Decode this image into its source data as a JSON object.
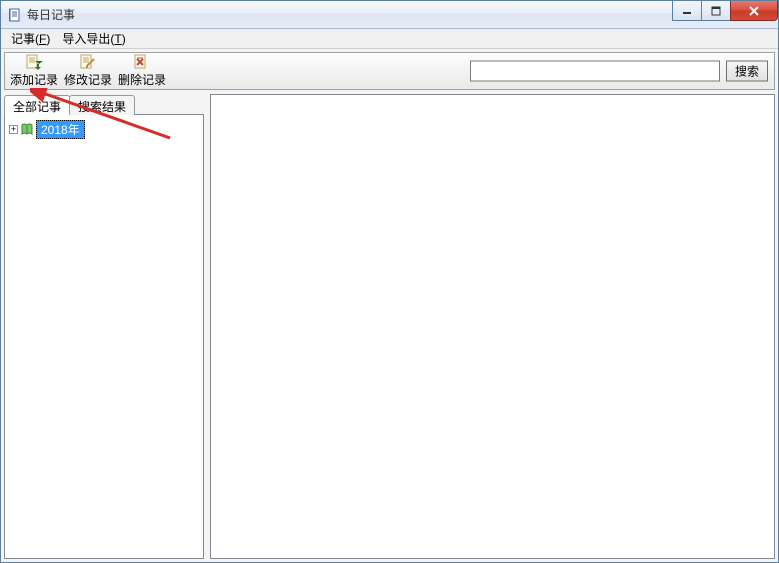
{
  "window": {
    "title": "每日记事"
  },
  "menubar": {
    "items": [
      {
        "label": "记事",
        "accel": "F"
      },
      {
        "label": "导入导出",
        "accel": "T"
      }
    ]
  },
  "toolbar": {
    "add_label": "添加记录",
    "edit_label": "修改记录",
    "delete_label": "删除记录"
  },
  "search": {
    "value": "",
    "placeholder": "",
    "button_label": "搜索"
  },
  "tabs": {
    "all_label": "全部记事",
    "results_label": "搜索结果"
  },
  "tree": {
    "items": [
      {
        "label": "2018年",
        "expanded": false,
        "selected": true
      }
    ]
  },
  "icons": {
    "app": "notebook-icon",
    "add": "document-add-icon",
    "edit": "document-edit-icon",
    "delete": "document-delete-icon",
    "tree_node": "book-icon"
  }
}
